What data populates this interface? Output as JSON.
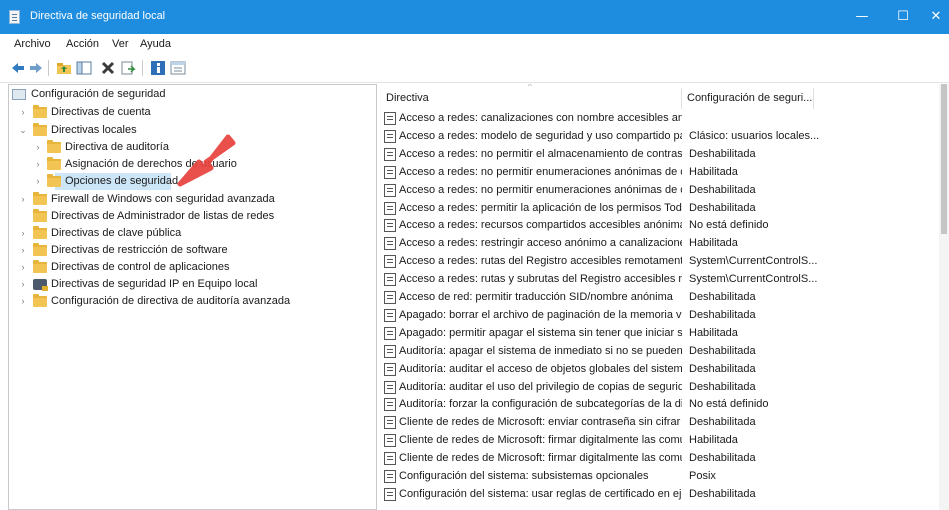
{
  "window": {
    "title": "Directiva de seguridad local",
    "minimize_glyph": "—",
    "maximize_glyph": "☐",
    "close_glyph": "✕"
  },
  "menu": [
    "Archivo",
    "Acción",
    "Ver",
    "Ayuda"
  ],
  "toolbar": {
    "icons": [
      "back-icon",
      "forward-icon",
      "up-folder-icon",
      "show-hide-tree-icon",
      "delete-icon",
      "export-list-icon",
      "help-icon",
      "properties-icon"
    ]
  },
  "tree": {
    "root": "Configuración de seguridad",
    "items": [
      {
        "label": "Directivas de cuenta",
        "level": 1,
        "expander": "›"
      },
      {
        "label": "Directivas locales",
        "level": 1,
        "expander": "⌄"
      },
      {
        "label": "Directiva de auditoría",
        "level": 2,
        "expander": "›"
      },
      {
        "label": "Asignación de derechos de usuario",
        "level": 2,
        "expander": "›"
      },
      {
        "label": "Opciones de seguridad",
        "level": 2,
        "expander": "›",
        "selected": true
      },
      {
        "label": "Firewall de Windows con seguridad avanzada",
        "level": 1,
        "expander": "›"
      },
      {
        "label": "Directivas de Administrador de listas de redes",
        "level": 1,
        "expander": ""
      },
      {
        "label": "Directivas de clave pública",
        "level": 1,
        "expander": "›"
      },
      {
        "label": "Directivas de restricción de software",
        "level": 1,
        "expander": "›"
      },
      {
        "label": "Directivas de control de aplicaciones",
        "level": 1,
        "expander": "›"
      },
      {
        "label": "Directivas de seguridad IP en Equipo local",
        "level": 1,
        "expander": "›"
      },
      {
        "label": "Configuración de directiva de auditoría avanzada",
        "level": 1,
        "expander": "›"
      }
    ]
  },
  "list": {
    "columns": [
      "Directiva",
      "Configuración de seguri..."
    ],
    "sort_caret": "^",
    "rows": [
      {
        "name": "Acceso a redes: canalizaciones con nombre accesibles anóni...",
        "setting": ""
      },
      {
        "name": "Acceso a redes: modelo de seguridad y uso compartido par...",
        "setting": "Clásico: usuarios locales..."
      },
      {
        "name": "Acceso a redes: no permitir el almacenamiento de contrase...",
        "setting": "Deshabilitada"
      },
      {
        "name": "Acceso a redes: no permitir enumeraciones anónimas de cu...",
        "setting": "Habilitada"
      },
      {
        "name": "Acceso a redes: no permitir enumeraciones anónimas de cu...",
        "setting": "Deshabilitada"
      },
      {
        "name": "Acceso a redes: permitir la aplicación de los permisos Todos...",
        "setting": "Deshabilitada"
      },
      {
        "name": "Acceso a redes: recursos compartidos accesibles anónimam...",
        "setting": "No está definido"
      },
      {
        "name": "Acceso a redes: restringir acceso anónimo a canalizaciones ...",
        "setting": "Habilitada"
      },
      {
        "name": "Acceso a redes: rutas del Registro accesibles remotamente",
        "setting": "System\\CurrentControlS..."
      },
      {
        "name": "Acceso a redes: rutas y subrutas del Registro accesibles rem...",
        "setting": "System\\CurrentControlS..."
      },
      {
        "name": "Acceso de red: permitir traducción SID/nombre anónima",
        "setting": "Deshabilitada"
      },
      {
        "name": "Apagado: borrar el archivo de paginación de la memoria virt...",
        "setting": "Deshabilitada"
      },
      {
        "name": "Apagado: permitir apagar el sistema sin tener que iniciar ses...",
        "setting": "Habilitada"
      },
      {
        "name": "Auditoría: apagar el sistema de inmediato si no se pueden re...",
        "setting": "Deshabilitada"
      },
      {
        "name": "Auditoría: auditar el acceso de objetos globales del sistema",
        "setting": "Deshabilitada"
      },
      {
        "name": "Auditoría: auditar el uso del privilegio de copias de segurida...",
        "setting": "Deshabilitada"
      },
      {
        "name": "Auditoría: forzar la configuración de subcategorías de la dire...",
        "setting": "No está definido"
      },
      {
        "name": "Cliente de redes de Microsoft: enviar contraseña sin cifrar a ...",
        "setting": "Deshabilitada"
      },
      {
        "name": "Cliente de redes de Microsoft: firmar digitalmente las comu...",
        "setting": "Habilitada"
      },
      {
        "name": "Cliente de redes de Microsoft: firmar digitalmente las comu...",
        "setting": "Deshabilitada"
      },
      {
        "name": "Configuración del sistema: subsistemas opcionales",
        "setting": "Posix"
      },
      {
        "name": "Configuración del sistema: usar reglas de certificado en ejec...",
        "setting": "Deshabilitada"
      }
    ]
  },
  "colors": {
    "titlebar": "#1f8ddf",
    "selection": "#cde6f7",
    "annotation_arrow": "#e8423c",
    "folder": "#f2c453"
  }
}
